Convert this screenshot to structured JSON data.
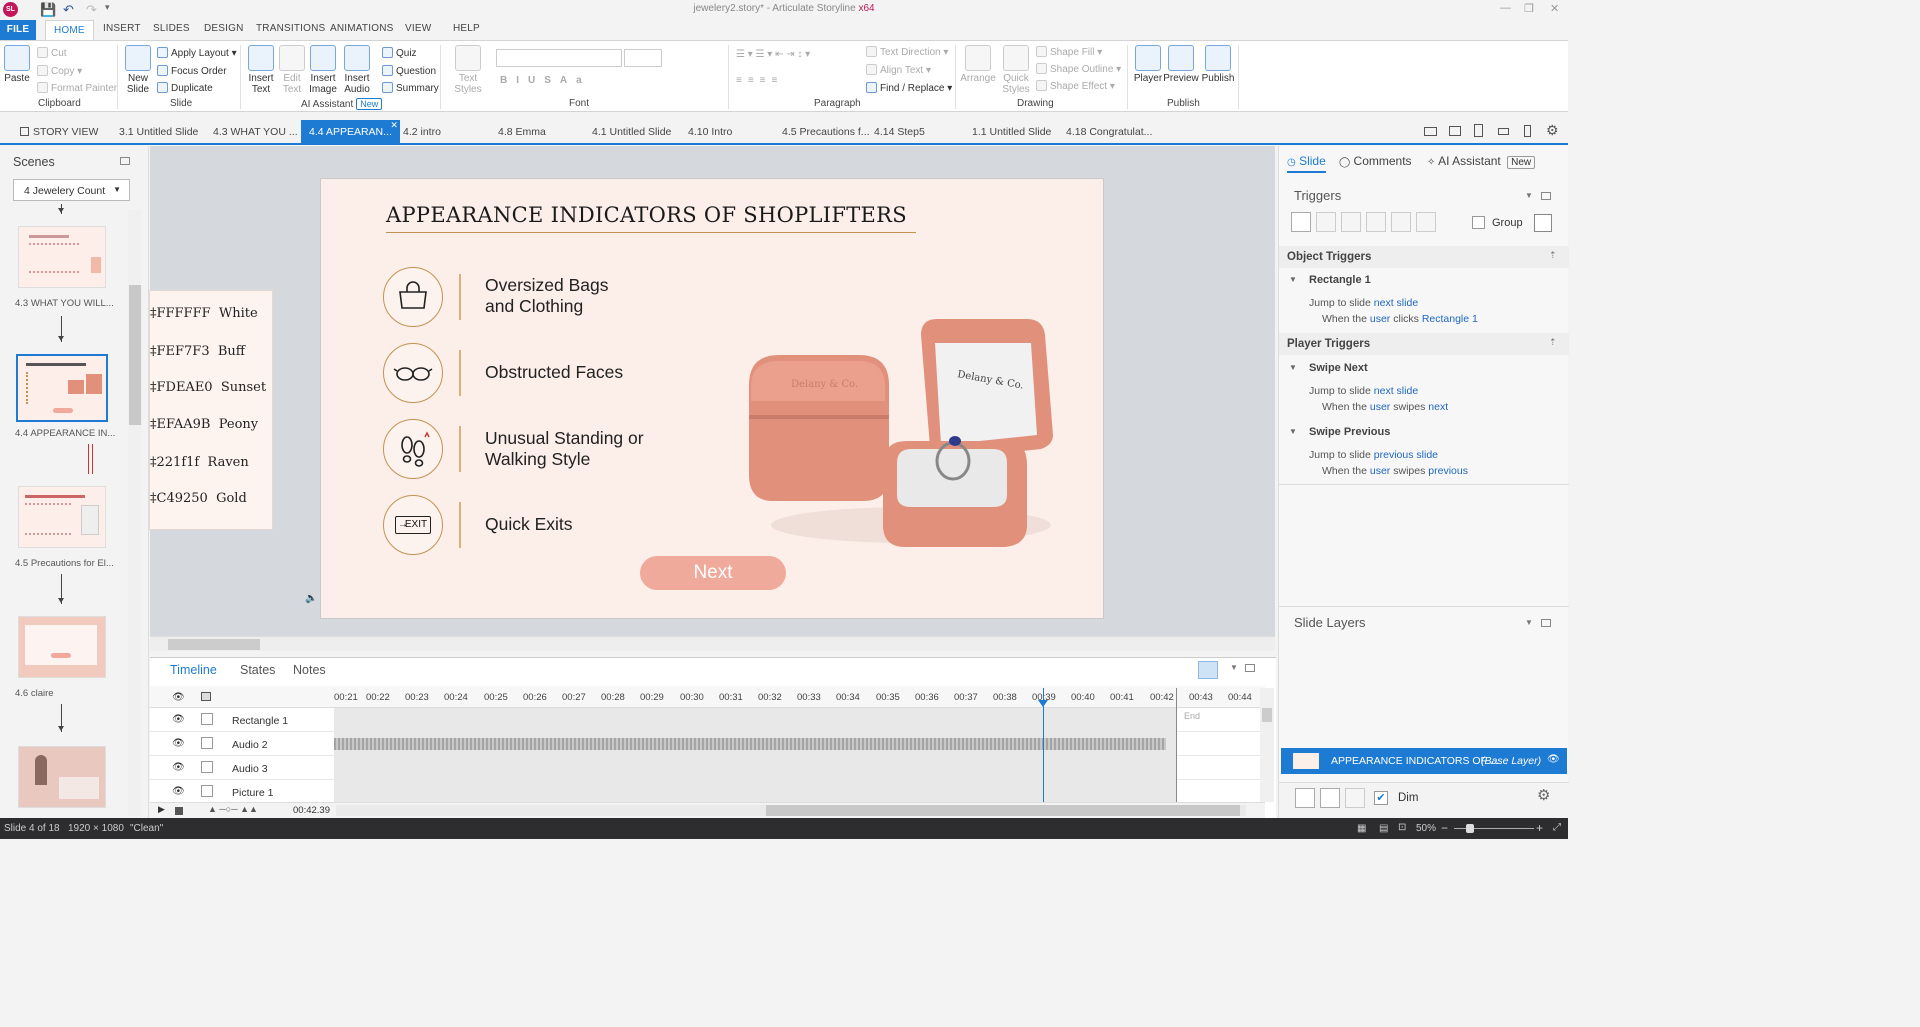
{
  "app": {
    "title": "jewelery2.story* - Articulate Storyline",
    "arch": "x64",
    "logo": "SL"
  },
  "ribbon_tabs": [
    "FILE",
    "HOME",
    "INSERT",
    "SLIDES",
    "DESIGN",
    "TRANSITIONS",
    "ANIMATIONS",
    "VIEW",
    "HELP"
  ],
  "ribbon": {
    "paste": "Paste",
    "cut": "Cut",
    "copy": "Copy",
    "format_painter": "Format Painter",
    "clipboard": "Clipboard",
    "new_slide": "New Slide",
    "apply_layout": "Apply Layout",
    "focus_order": "Focus Order",
    "duplicate": "Duplicate",
    "slide_group": "Slide",
    "insert_text": "Insert Text",
    "edit_text": "Edit Text",
    "insert_image": "Insert Image",
    "insert_audio": "Insert Audio",
    "quiz": "Quiz",
    "question": "Question",
    "summary": "Summary",
    "ai_assistant": "AI Assistant",
    "new_badge": "New",
    "text_styles": "Text Styles",
    "font": "Font",
    "text_direction": "Text Direction",
    "align_text": "Align Text",
    "find_replace": "Find / Replace",
    "paragraph": "Paragraph",
    "arrange": "Arrange",
    "quick_styles": "Quick Styles",
    "shape_fill": "Shape Fill",
    "shape_outline": "Shape Outline",
    "shape_effect": "Shape Effect",
    "drawing": "Drawing",
    "player": "Player",
    "preview": "Preview",
    "publish": "Publish",
    "publish_group": "Publish"
  },
  "slide_tabs": [
    "STORY VIEW",
    "3.1 Untitled Slide",
    "4.3 WHAT YOU ...",
    "4.4 APPEARAN...",
    "4.2 intro",
    "4.8 Emma",
    "4.1 Untitled Slide",
    "4.10 Intro",
    "4.5 Precautions f...",
    "4.14 Step5",
    "1.1 Untitled Slide",
    "4.18 Congratulat..."
  ],
  "scenes": {
    "header": "Scenes",
    "dropdown": "4 Jewelery Count",
    "thumbs": [
      "4.3 WHAT YOU WILL...",
      "4.4 APPEARANCE IN...",
      "4.5 Precautions for El...",
      "4.6 claire"
    ]
  },
  "slide": {
    "title": "APPEARANCE INDICATORS OF SHOPLIFTERS",
    "items": [
      {
        "icon": "bag-icon",
        "line1": "Oversized Bags",
        "line2": "and Clothing"
      },
      {
        "icon": "sunglasses-icon",
        "line1": "Obstructed Faces",
        "line2": ""
      },
      {
        "icon": "footprints-icon",
        "line1": "Unusual Standing or",
        "line2": "Walking Style"
      },
      {
        "icon": "exit-sign-icon",
        "line1": "Quick Exits",
        "line2": ""
      }
    ],
    "exit_icon_text": "EXIT",
    "next_button": "Next",
    "box_brand": "Delany & Co."
  },
  "color_palette": [
    {
      "code": "FFFFFF",
      "name": "White"
    },
    {
      "code": "FEF7F3",
      "name": "Buff"
    },
    {
      "code": "FDEAE0",
      "name": "Sunset"
    },
    {
      "code": "EFAA9B",
      "name": "Peony"
    },
    {
      "code": "221f1f",
      "name": "Raven"
    },
    {
      "code": "C49250",
      "name": "Gold"
    }
  ],
  "color_prefixes": [
    "‡",
    "‡",
    "‡",
    "‡",
    "‡",
    "‡"
  ],
  "timeline": {
    "tabs": [
      "Timeline",
      "States",
      "Notes"
    ],
    "ticks": [
      "00:21",
      "00:22",
      "00:23",
      "00:24",
      "00:25",
      "00:26",
      "00:27",
      "00:28",
      "00:29",
      "00:30",
      "00:31",
      "00:32",
      "00:33",
      "00:34",
      "00:35",
      "00:36",
      "00:37",
      "00:38",
      "00:39",
      "00:40",
      "00:41",
      "00:42",
      "00:43",
      "00:44"
    ],
    "rows": [
      "Rectangle 1",
      "Audio 2",
      "Audio 3",
      "Picture 1"
    ],
    "end_label": "End",
    "time": "00:42.39"
  },
  "right_panel": {
    "tabs": [
      "Slide",
      "Comments",
      "AI Assistant"
    ],
    "new_badge": "New",
    "triggers": "Triggers",
    "group": "Group",
    "object_triggers": "Object Triggers",
    "player_triggers": "Player Triggers",
    "t1": {
      "name": "Rectangle 1",
      "action": "Jump to slide",
      "target": "next slide",
      "when": "When the",
      "who": "user",
      "verb": "clicks",
      "obj": "Rectangle 1"
    },
    "t2": {
      "name": "Swipe Next",
      "action": "Jump to slide",
      "target": "next slide",
      "when": "When the",
      "who": "user",
      "verb": "swipes",
      "obj": "next"
    },
    "t3": {
      "name": "Swipe Previous",
      "action": "Jump to slide",
      "target": "previous slide",
      "when": "When the",
      "who": "user",
      "verb": "swipes",
      "obj": "previous"
    },
    "slide_layers": "Slide Layers",
    "base_layer_name": "APPEARANCE INDICATORS OF ...",
    "base_layer_tag": "(Base Layer)",
    "dim": "Dim"
  },
  "status": {
    "slide": "Slide 4 of 18",
    "size": "1920 × 1080",
    "theme": "\"Clean\"",
    "zoom": "50%"
  },
  "colors": {
    "accent": "#1e7bd4",
    "slide_bg": "#fcefea",
    "peony": "#efaa9b",
    "gold": "#c49250",
    "box": "#e1907c"
  }
}
